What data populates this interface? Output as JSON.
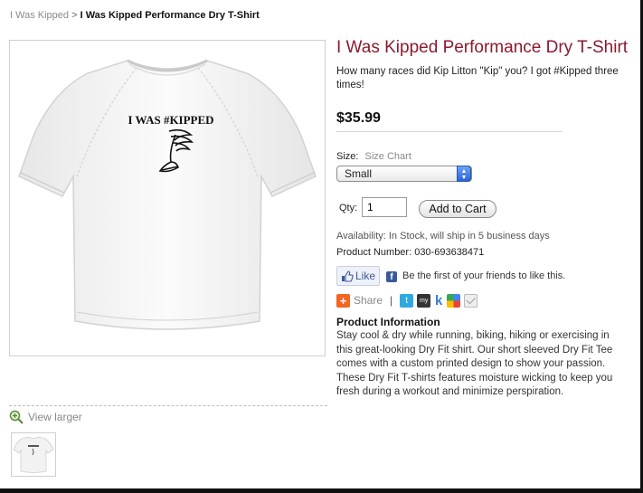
{
  "breadcrumb": {
    "parent": "I Was Kipped",
    "separator": ">",
    "current": "I Was Kipped Performance Dry T-Shirt"
  },
  "product": {
    "title": "I Was Kipped Performance Dry T-Shirt",
    "tagline": "How many races did Kip Litton \"Kip\" you? I got #Kipped three times!",
    "price": "$35.99",
    "shirt_print": "I WAS #KIPPED",
    "title_color": "#8b1a2f"
  },
  "options": {
    "size_label": "Size:",
    "size_chart_link": "Size Chart",
    "size_selected": "Small",
    "qty_label": "Qty:",
    "qty_value": "1",
    "add_to_cart_label": "Add to Cart"
  },
  "availability": "Availability: In Stock, will ship in 5 business days",
  "product_number": "Product Number: 030-693638471",
  "social": {
    "like_label": "Like",
    "facebook_text": "Be the first of your friends to like this.",
    "share_label": "Share",
    "pipe": "|",
    "icons": [
      "share-plus-icon",
      "twitter-icon",
      "myspace-icon",
      "kaboodle-icon",
      "google-icon",
      "email-icon"
    ]
  },
  "info": {
    "heading": "Product Information",
    "lines": [
      "Stay cool & dry while running, biking, hiking or exercising in",
      "this great-looking Dry Fit shirt. Our short sleeved Dry Fit Tee",
      "comes with a custom printed design to show your passion.",
      "These Dry Fit T-shirts features moisture wicking to keep you",
      "fresh during a workout and minimize perspiration."
    ]
  },
  "gallery": {
    "view_larger": "View larger",
    "zoom_icon": "magnifier-icon"
  }
}
